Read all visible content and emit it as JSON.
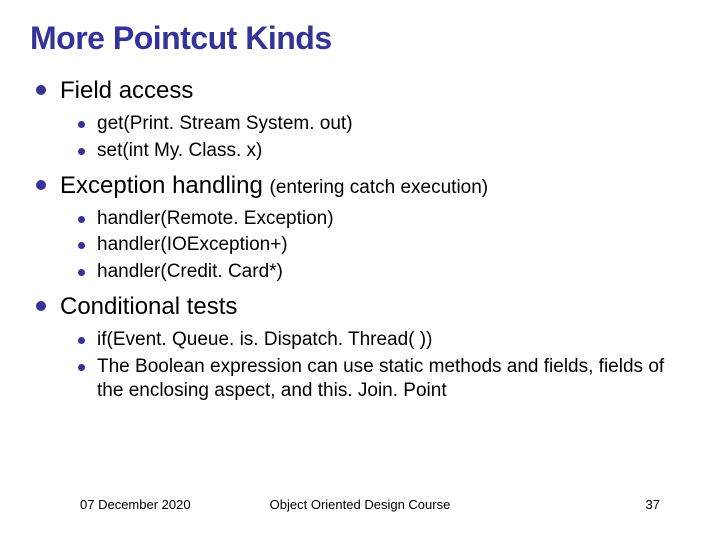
{
  "title": "More Pointcut Kinds",
  "sections": [
    {
      "heading": "Field access",
      "items": [
        "get(Print. Stream System. out)",
        "set(int My. Class. x)"
      ]
    },
    {
      "heading": "Exception handling",
      "headingParen": "(entering catch execution)",
      "items": [
        "handler(Remote. Exception)",
        "handler(IOException+)",
        "handler(Credit. Card*)"
      ]
    },
    {
      "heading": "Conditional tests",
      "items": [
        "if(Event. Queue. is. Dispatch. Thread( ))",
        "The Boolean expression can use static methods and fields, fields of the enclosing aspect, and this. Join. Point"
      ]
    }
  ],
  "footer": {
    "date": "07 December 2020",
    "course": "Object Oriented Design Course",
    "page": "37"
  }
}
